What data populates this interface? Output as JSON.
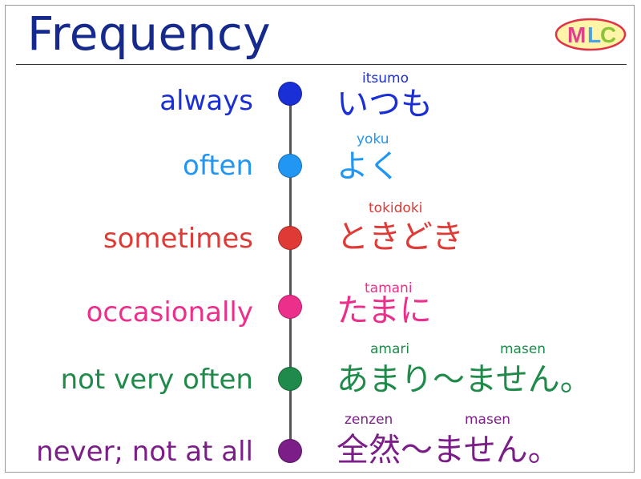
{
  "title": "Frequency",
  "logo": {
    "letters": [
      "M",
      "L",
      "C"
    ]
  },
  "colors": {
    "title": "#152a8c",
    "always": "#1b2fd6",
    "often": "#2196f3",
    "sometimes": "#e03a36",
    "occasionally": "#ec2f8a",
    "not_very_often": "#1f8a4a",
    "never": "#7b1e88"
  },
  "rows": [
    {
      "english": "always",
      "japanese": "いつも",
      "romaji": [
        "itsumo"
      ]
    },
    {
      "english": "often",
      "japanese": "よく",
      "romaji": [
        "yoku"
      ]
    },
    {
      "english": "sometimes",
      "japanese": "ときどき",
      "romaji": [
        "tokidoki"
      ]
    },
    {
      "english": "occasionally",
      "japanese": "たまに",
      "romaji": [
        "tamani"
      ]
    },
    {
      "english": "not very often",
      "japanese": "あまり〜ません。",
      "romaji": [
        "amari",
        "masen"
      ]
    },
    {
      "english": "never; not at all",
      "japanese": "全然〜ません。",
      "romaji": [
        "zenzen",
        "masen"
      ]
    }
  ]
}
